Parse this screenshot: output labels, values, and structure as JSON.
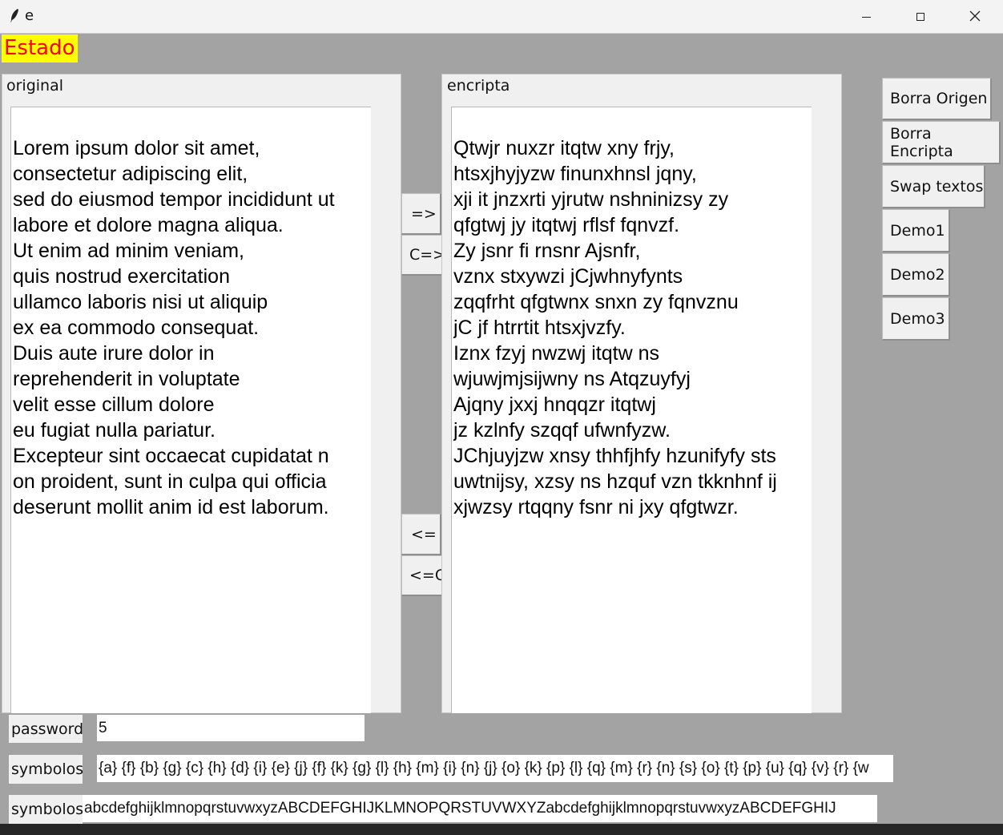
{
  "window": {
    "title": "e",
    "icon": "feather-icon",
    "controls": [
      "minimize-icon",
      "maximize-icon",
      "close-icon"
    ]
  },
  "status": {
    "label": "Estado"
  },
  "original": {
    "legend": "original",
    "text": "Lorem ipsum dolor sit amet,\nconsectetur adipiscing elit,\nsed do eiusmod tempor incididunt ut\nlabore et dolore magna aliqua.\nUt enim ad minim veniam,\nquis nostrud exercitation\nullamco laboris nisi ut aliquip\nex ea commodo consequat.\nDuis aute irure dolor in\nreprehenderit in voluptate\nvelit esse cillum dolore\neu fugiat nulla pariatur.\nExcepteur sint occaecat cupidatat n\non proident, sunt in culpa qui officia\ndeserunt mollit anim id est laborum."
  },
  "encripta": {
    "legend": "encripta",
    "text": "Qtwjr nuxzr itqtw xny frjy,\nhtsxjhyjyzw finunxhnsl jqny,\nxji it jnzxrti yjrutw nshninizsy zy\nqfgtwj jy itqtwj rflsf fqnvzf.\nZy jsnr fi rnsnr Ajsnfr,\nvznx stxywzi jCjwhnyfynts\nzqqfrht qfgtwnx snxn zy fqnvznu\njC jf htrrtit htsxjvzfy.\nIznx fzyj nwzwj itqtw ns\nwjuwjmjsijwny ns Atqzuyfyj\nAjqny jxxj hnqqzr itqtwj\njz kzlnfy szqqf ufwnfyzw.\nJChjuyjzw xnsy thhfjhfy hzunifyfy sts\nuwtnijsy, xzsy ns hzquf vzn tkknhnf ij\nxjwzsy rtqqny fsnr ni jxy qfgtwzr."
  },
  "middle_buttons": {
    "encrypt": "=>",
    "encrypt_c": "C=>",
    "decrypt": "<=",
    "decrypt_c": "<=C"
  },
  "side_buttons": {
    "borra_origen": "Borra Origen",
    "borra_encripta": "Borra Encripta",
    "swap": "Swap textos",
    "demo1": "Demo1",
    "demo2": "Demo2",
    "demo3": "Demo3"
  },
  "password": {
    "label": "password",
    "value": "5"
  },
  "symbols_map": {
    "label": "symbolos",
    "value": "{a} {f} {b} {g} {c} {h} {d} {i} {e} {j} {f} {k} {g} {l} {h} {m} {i} {n} {j} {o} {k} {p} {l} {q} {m} {r} {n} {s} {o} {t} {p} {u} {q} {v} {r} {w"
  },
  "symbols_alpha": {
    "label": "symbolos",
    "value": "abcdefghijklmnopqrstuvwxyzABCDEFGHIJKLMNOPQRSTUVWXYZabcdefghijklmnopqrstuvwxyzABCDEFGHIJ"
  }
}
